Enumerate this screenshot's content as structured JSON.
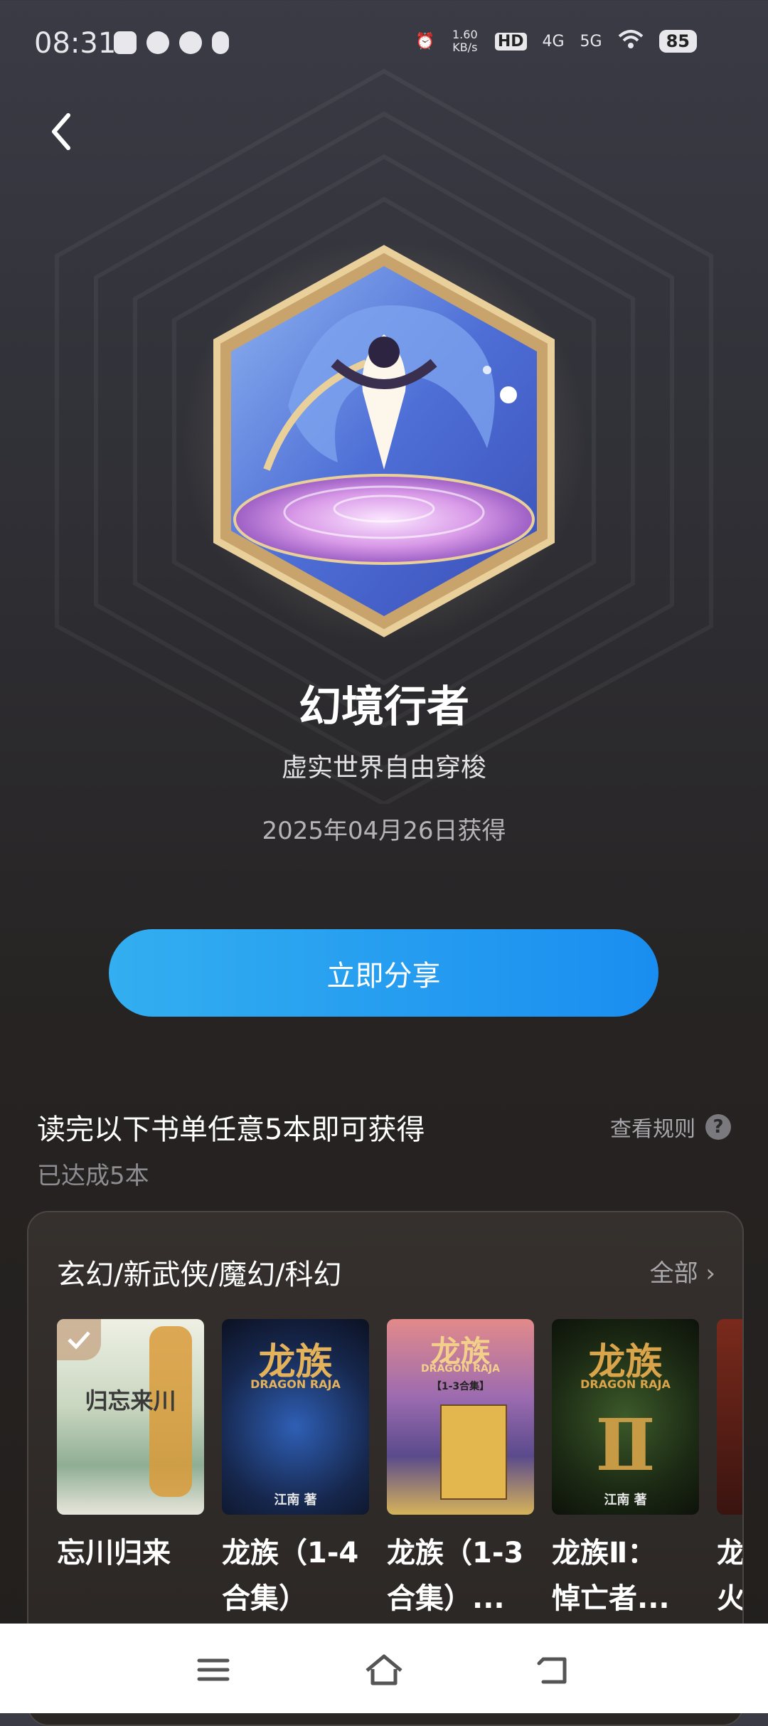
{
  "status_bar": {
    "time": "08:31",
    "net_speed": "1.60 KB/s",
    "hd": "HD",
    "sig1": "4G",
    "sig2": "5G",
    "battery": "85"
  },
  "badge": {
    "name": "幻境行者",
    "description": "虚实世界自由穿梭",
    "obtained_date": "2025年04月26日获得"
  },
  "share_button": "立即分享",
  "requirement": {
    "title": "读完以下书单任意5本即可获得",
    "progress": "已达成5本",
    "rules_link": "查看规则",
    "help": "?"
  },
  "book_list": {
    "category": "玄幻/新武侠/魔幻/科幻",
    "all_link": "全部",
    "books": [
      {
        "title_line1": "忘川归来",
        "title_line2": "",
        "cover_text": "归忘来川",
        "cover_author": "",
        "completed": true
      },
      {
        "title_line1": "龙族（1-4",
        "title_line2": "合集）",
        "cover_text": "龙族",
        "cover_sub": "DRAGON RAJA",
        "cover_author": "江南 著",
        "completed": false
      },
      {
        "title_line1": "龙族（1-3",
        "title_line2": "合集）...",
        "cover_text": "龙族",
        "cover_sub": "DRAGON RAJA",
        "cover_author": "【1-3合集】",
        "completed": false
      },
      {
        "title_line1": "龙族Ⅱ：",
        "title_line2": "悼亡者...",
        "cover_text": "龙族",
        "cover_sub": "DRAGON RAJA",
        "cover_author": "江南 著",
        "completed": false
      },
      {
        "title_line1": "龙",
        "title_line2": "火",
        "cover_text": "",
        "cover_author": "",
        "completed": false
      }
    ]
  }
}
